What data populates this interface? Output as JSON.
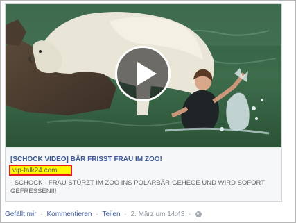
{
  "post": {
    "video": {
      "play_icon": "play-icon"
    },
    "title": "[SCHOCK VIDEO] BÄR FRISST FRAU IM ZOO!",
    "domain": "vip-talk24.com",
    "description": "- SCHOCK - FRAU STÜRZT IM ZOO INS POLARBÄR-GEHEGE UND WIRD SOFORT GEFRESSEN!!!"
  },
  "actions": {
    "like": "Gefällt mir",
    "comment": "Kommentieren",
    "share": "Teilen",
    "timestamp": "2. März um 14:43",
    "separator": "·",
    "privacy_icon": "globe-icon"
  },
  "colors": {
    "link_blue": "#3b5998",
    "highlight_yellow": "#fff700",
    "highlight_border": "#e31b1b"
  }
}
